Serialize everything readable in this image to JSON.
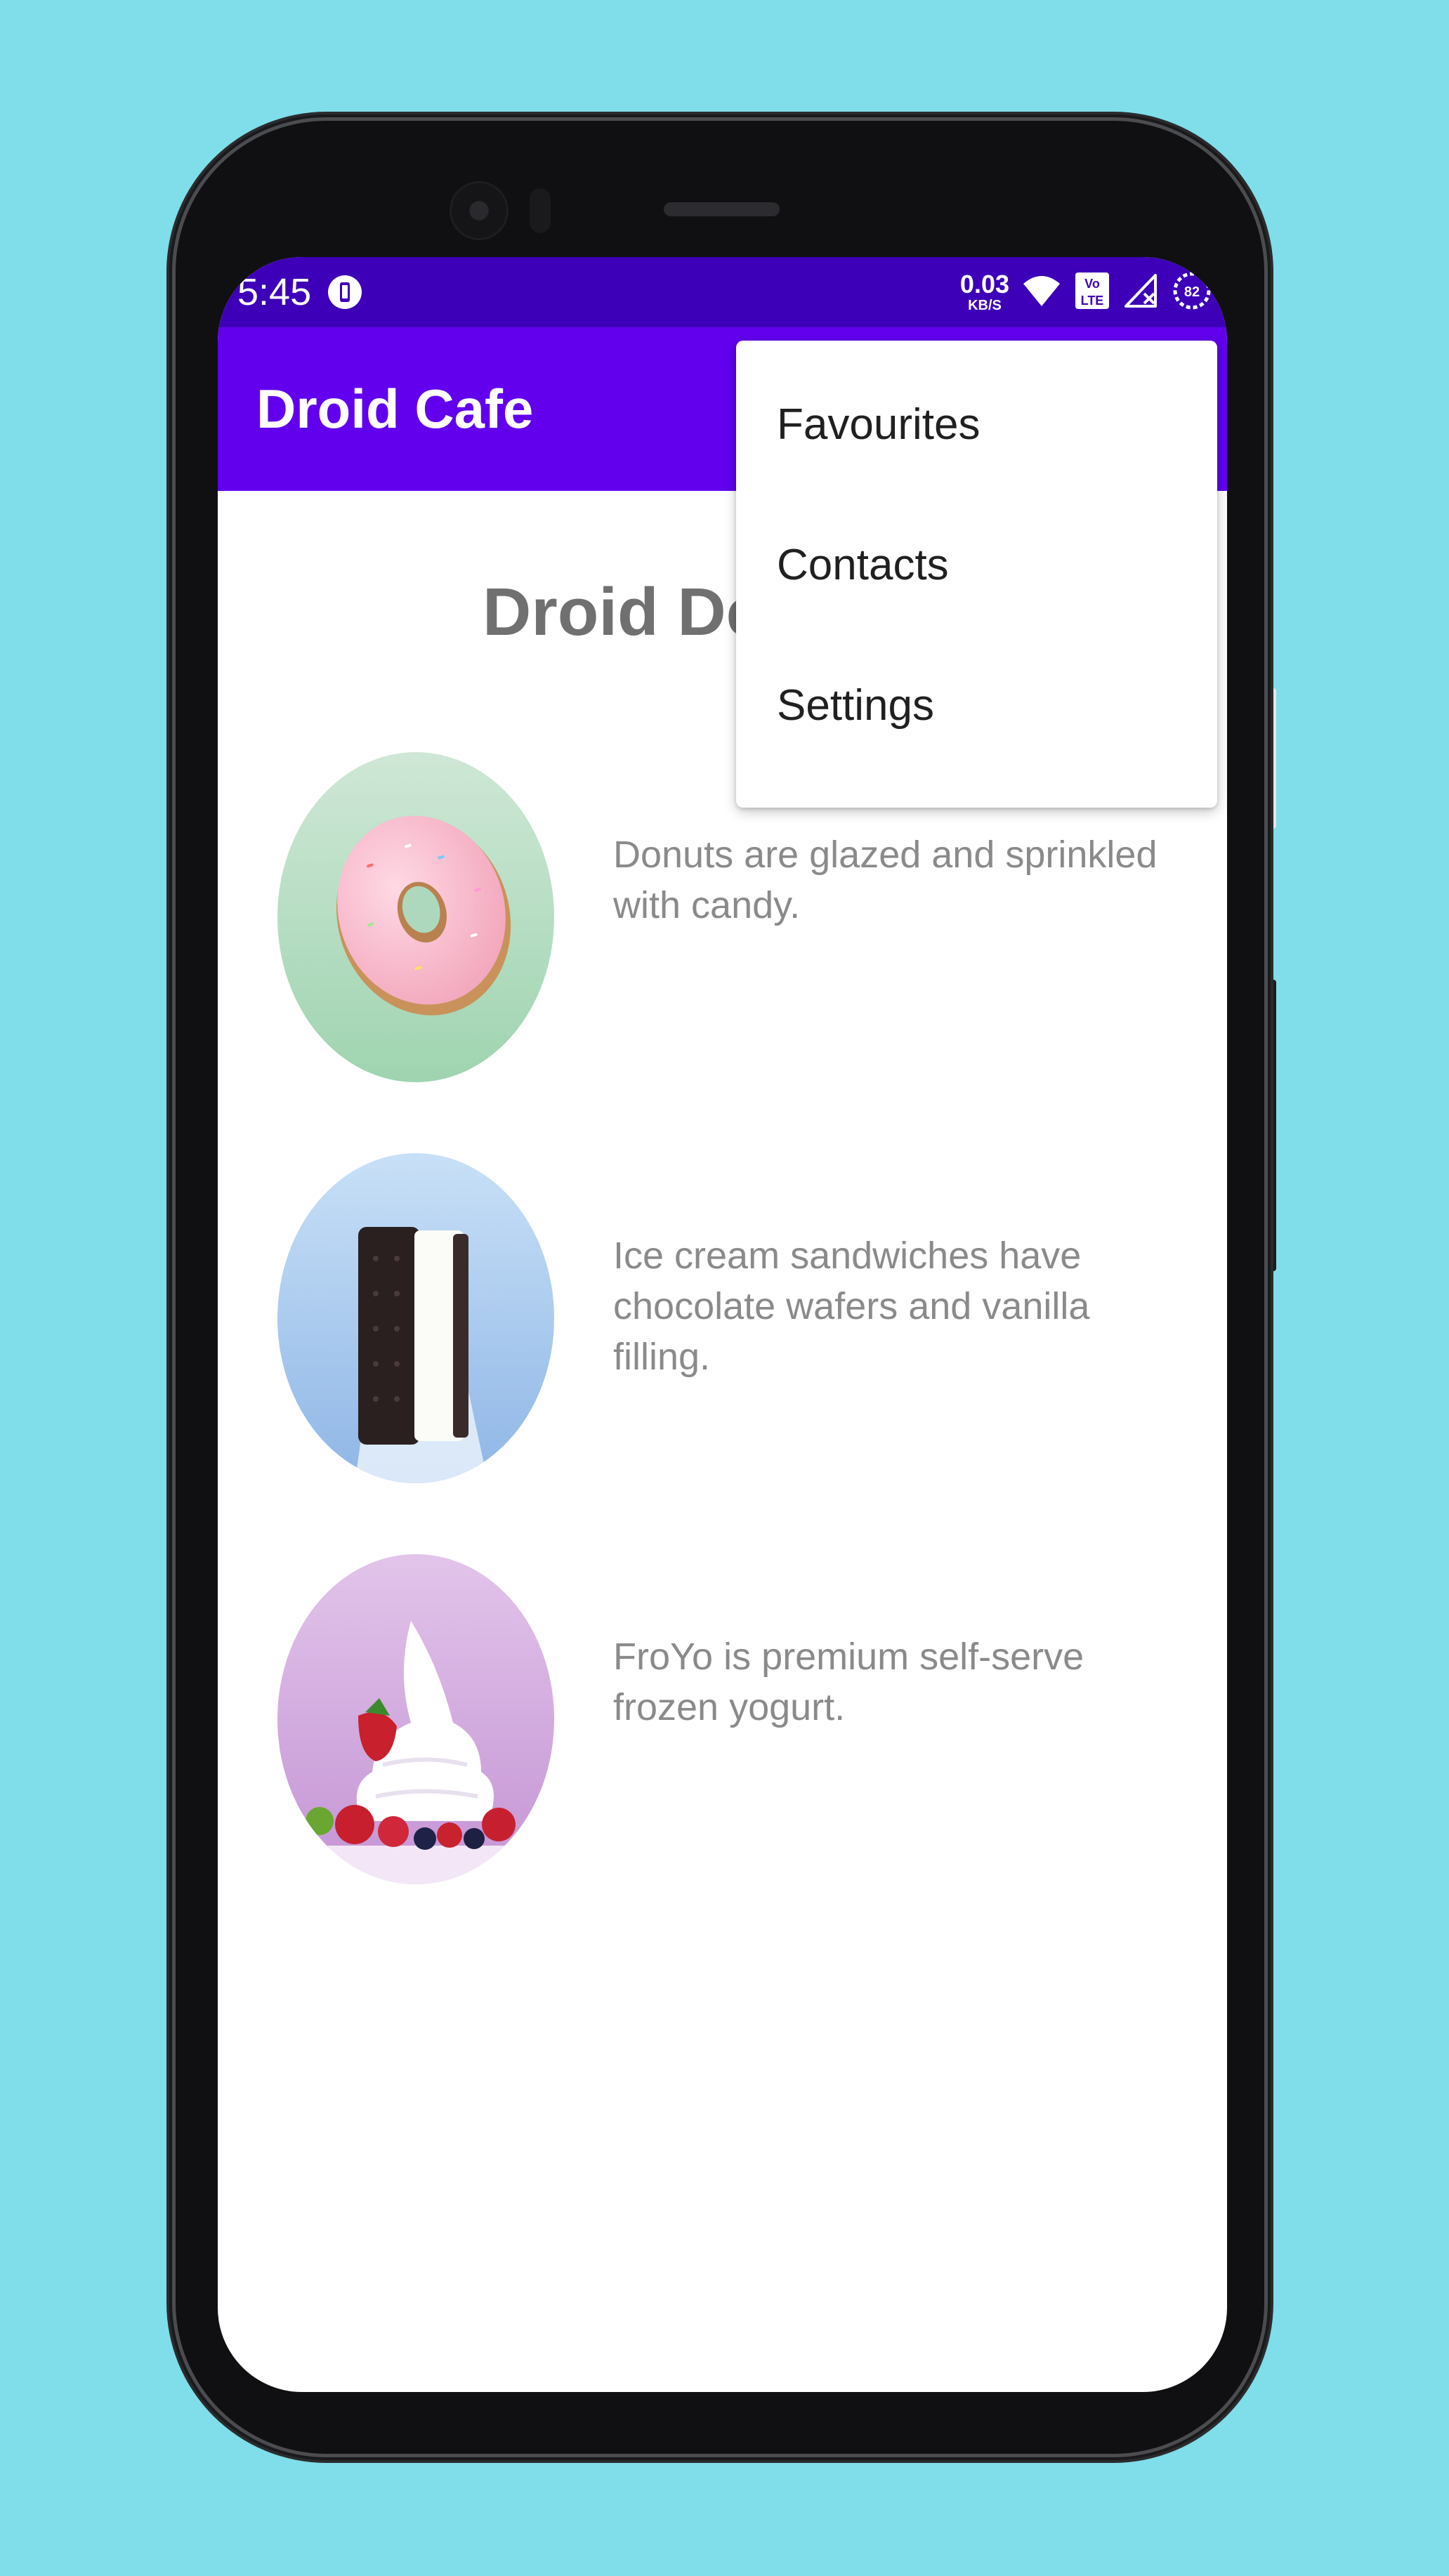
{
  "status_bar": {
    "time": "5:45",
    "net_speed_value": "0.03",
    "net_speed_unit": "KB/S",
    "battery": "82"
  },
  "app_bar": {
    "title": "Droid Cafe"
  },
  "main": {
    "heading": "Droid Desserts",
    "items": [
      {
        "name": "donut",
        "description": "Donuts are glazed and sprinkled with candy."
      },
      {
        "name": "ice-cream-sandwich",
        "description": "Ice cream sandwiches have chocolate wafers and vanilla filling."
      },
      {
        "name": "froyo",
        "description": "FroYo is premium self-serve frozen yogurt."
      }
    ]
  },
  "overflow_menu": {
    "items": [
      "Favourites",
      "Contacts",
      "Settings"
    ]
  },
  "colors": {
    "background": "#7fdeea",
    "status_bar": "#3d00b8",
    "app_bar": "#6200ee",
    "heading_text": "#707070",
    "body_text": "#8a8a8a"
  }
}
